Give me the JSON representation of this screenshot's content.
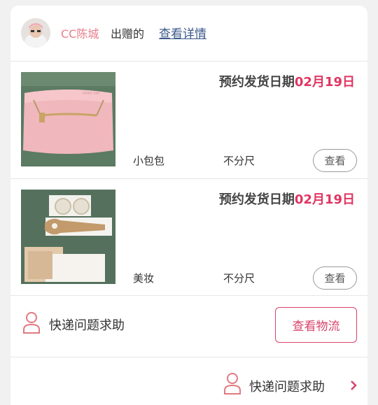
{
  "header": {
    "giver_name": "CC陈城",
    "gave_text": "出赠的",
    "details_link": "查看详情"
  },
  "items": [
    {
      "ship_label": "预约发货日期",
      "ship_date": "02月19日",
      "name": "小包包",
      "size": "不分尺",
      "view_label": "查看"
    },
    {
      "ship_label": "预约发货日期",
      "ship_date": "02月19日",
      "name": "美妆",
      "size": "不分尺",
      "view_label": "查看"
    }
  ],
  "help": {
    "label": "快递问题求助",
    "logistics_button": "查看物流"
  },
  "footer": {
    "label": "快递问题求助"
  },
  "colors": {
    "accent": "#e03562",
    "giver": "#e87d8a",
    "link": "#3c5a8a"
  }
}
